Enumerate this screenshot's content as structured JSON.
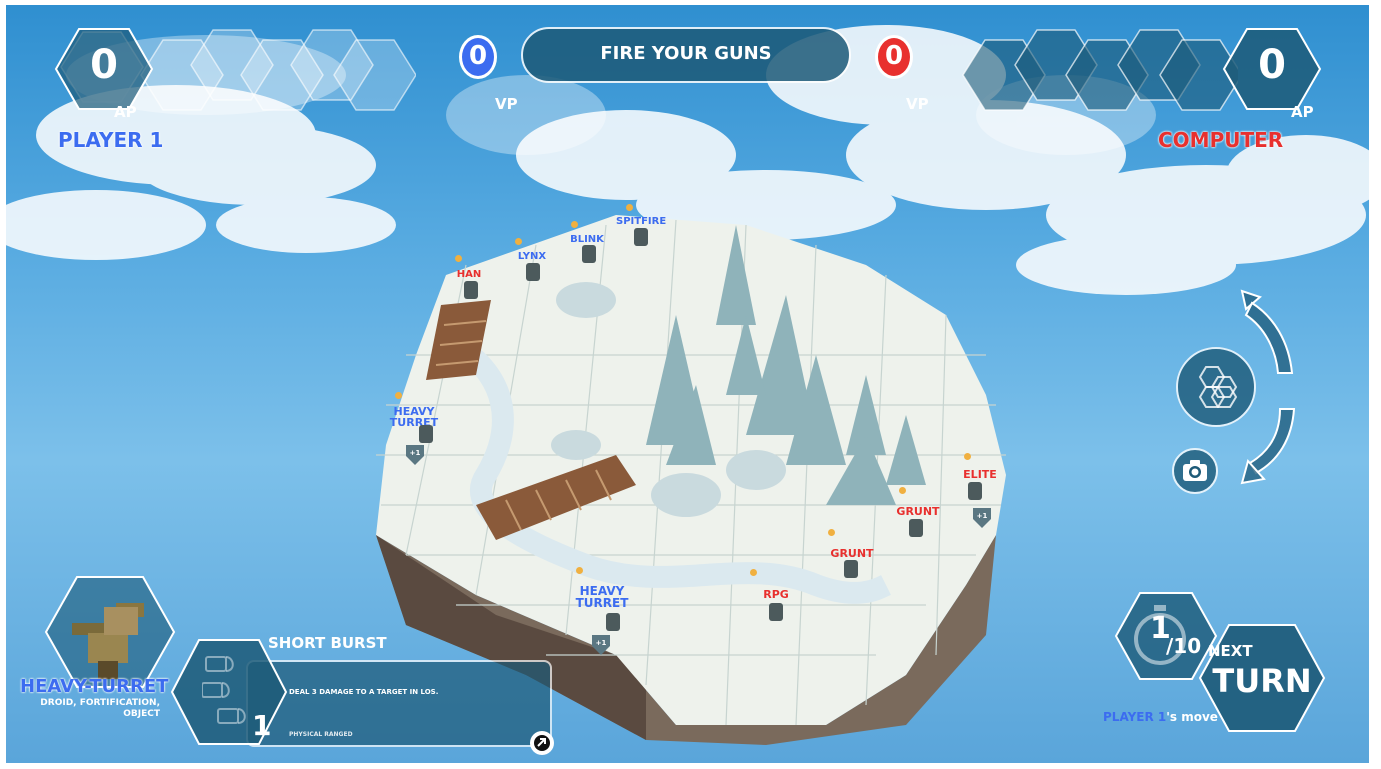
{
  "hud": {
    "player": {
      "ap_value": "0",
      "ap_label": "AP",
      "name": "PLAYER 1"
    },
    "computer": {
      "ap_value": "0",
      "ap_label": "AP",
      "name": "COMPUTER"
    },
    "center_banner": "FIRE YOUR GUNS",
    "vp_left": {
      "value": "0",
      "label": "VP"
    },
    "vp_right": {
      "value": "0",
      "label": "VP"
    }
  },
  "units": [
    {
      "label": "HAN",
      "team": "red"
    },
    {
      "label": "LYNX",
      "team": "blue"
    },
    {
      "label": "BLINK",
      "team": "blue"
    },
    {
      "label": "SPITFIRE",
      "team": "blue"
    },
    {
      "label": "HEAVY TURRET",
      "team": "blue"
    },
    {
      "label": "HEAVY TURRET",
      "team": "blue"
    },
    {
      "label": "ELITE",
      "team": "red"
    },
    {
      "label": "GRUNT",
      "team": "red"
    },
    {
      "label": "GRUNT",
      "team": "red"
    },
    {
      "label": "RPG",
      "team": "red"
    }
  ],
  "shield_badge": "+1",
  "selected_unit": {
    "name": "HEAVY-TURRET",
    "tags": "DROID, FORTIFICATION, OBJECT",
    "ability": {
      "title": "SHORT BURST",
      "description": "DEAL 3 DAMAGE TO A TARGET IN LOS.",
      "type": "PHYSICAL RANGED",
      "ammo_count": "1"
    }
  },
  "turn": {
    "current": "1",
    "total": "/10",
    "next_label": "NEXT",
    "turn_label": "TURN",
    "status_player": "PLAYER 1",
    "status_suffix": "'s move"
  },
  "icons": {
    "rotate_cw": "rotate-arrow-up-icon",
    "rotate_ccw": "rotate-arrow-down-icon",
    "map": "hex-grid-icon",
    "camera": "camera-icon",
    "timer": "stopwatch-icon",
    "bullet": "bullet-icon",
    "info": "info-icon"
  },
  "colors": {
    "blue_team": "#3c6cf0",
    "red_team": "#e8302e",
    "hud_dark": "#1d5a78",
    "hud_border": "#ffffff"
  }
}
